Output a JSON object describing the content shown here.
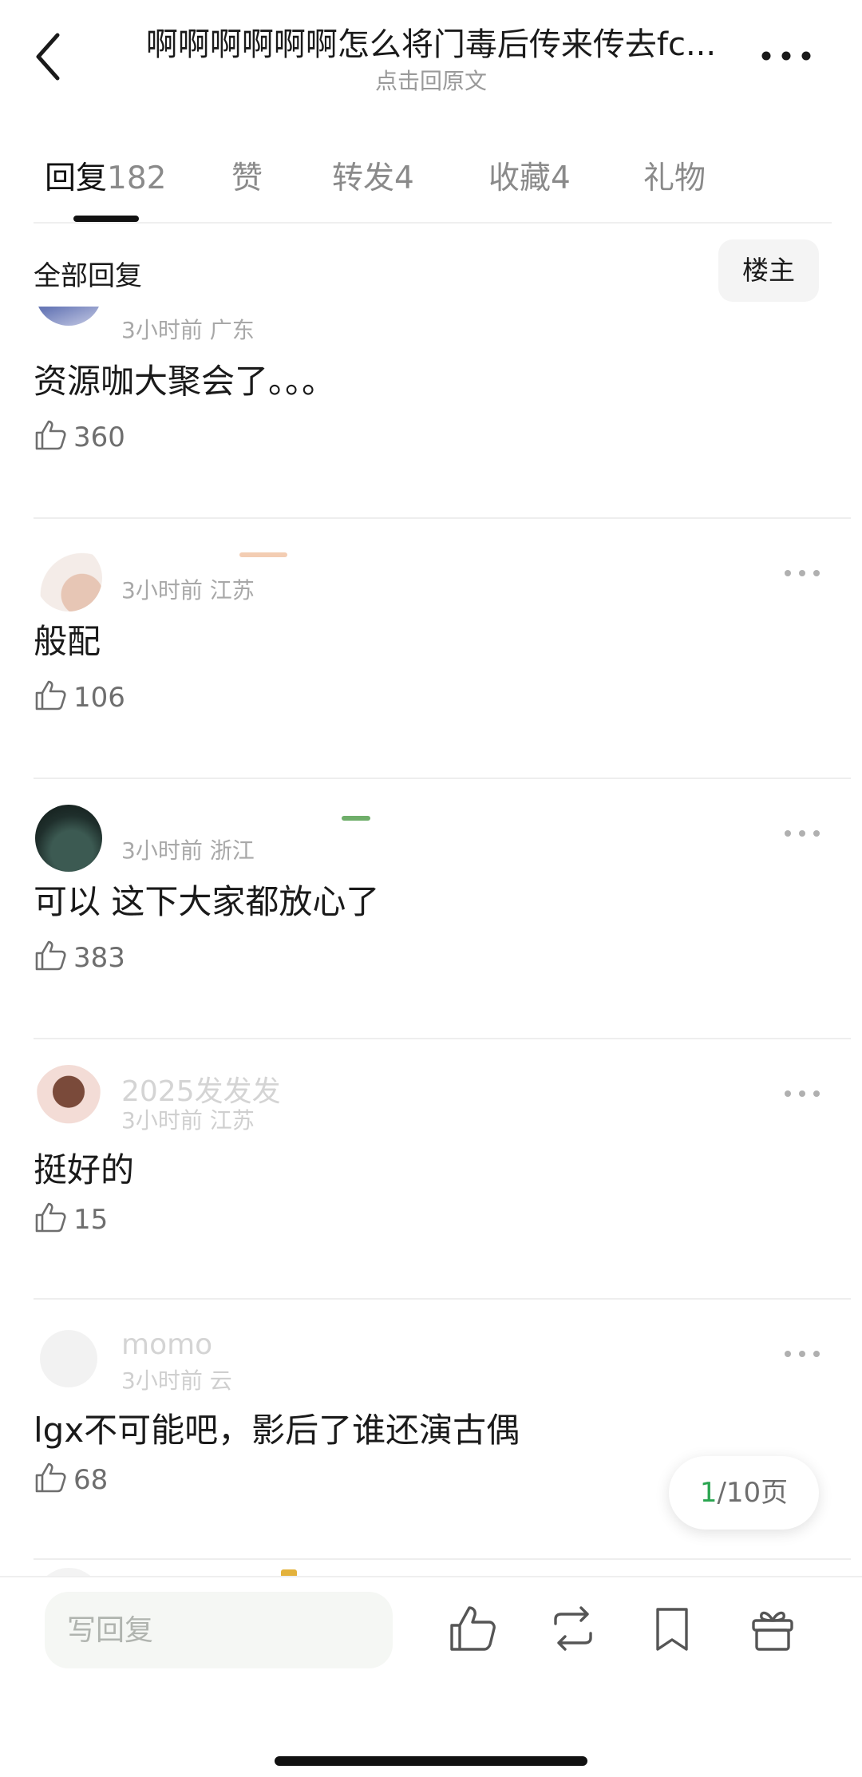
{
  "header": {
    "title": "啊啊啊啊啊啊怎么将门毒后传来传去fc...",
    "subtitle": "点击回原文"
  },
  "tabs": [
    {
      "label": "回复",
      "count": "182"
    },
    {
      "label": "赞",
      "count": ""
    },
    {
      "label": "转发",
      "count": "4"
    },
    {
      "label": "收藏",
      "count": "4"
    },
    {
      "label": "礼物",
      "count": ""
    }
  ],
  "filter": {
    "label": "全部回复",
    "owner_button": "楼主"
  },
  "comments": [
    {
      "meta": "3小时前 广东",
      "text": "资源咖大聚会了。。。",
      "likes": "360"
    },
    {
      "meta": "3小时前 江苏",
      "text": "般配",
      "likes": "106"
    },
    {
      "meta": "3小时前 浙江",
      "text": "可以 这下大家都放心了",
      "likes": "383"
    },
    {
      "username": "2025发发发",
      "meta": "3小时前 江苏",
      "text": "挺好的",
      "likes": "15"
    },
    {
      "username": "momo",
      "meta": "3小时前 云",
      "text": "lgx不可能吧，影后了谁还演古偶",
      "likes": "68"
    }
  ],
  "pager": {
    "current": "1",
    "total": "/10页"
  },
  "bottom_bar": {
    "reply_placeholder": "写回复"
  },
  "icons": [
    "back-arrow-icon",
    "more-icon",
    "thumbs-up-icon",
    "repost-icon",
    "bookmark-icon",
    "gift-icon"
  ],
  "colors": {
    "accent_green": "#2aa550",
    "text_gray": "#8a8a8a",
    "divider": "#eeeeee"
  }
}
